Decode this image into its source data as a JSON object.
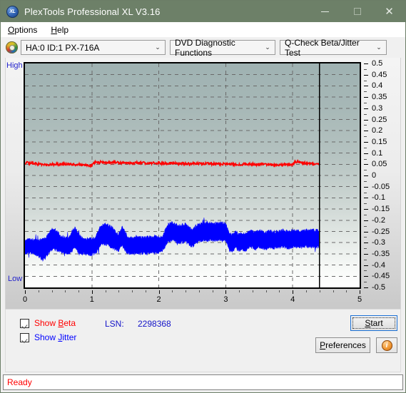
{
  "window": {
    "title": "PlexTools Professional XL V3.16",
    "icon": "xl-disc-icon",
    "minimize_label": "–",
    "maximize_label": "□",
    "close_label": "✕",
    "titlebar_color": "#6d8068"
  },
  "menu": {
    "items": [
      {
        "label": "Options",
        "accel": "O"
      },
      {
        "label": "Help",
        "accel": "H"
      }
    ]
  },
  "toolbar": {
    "drive_icon": "optical-disc-icon",
    "drive_select": "HA:0 ID:1  PX-716A",
    "function_select": "DVD Diagnostic Functions",
    "test_select": "Q-Check Beta/Jitter Test",
    "chevron": "⌄"
  },
  "controls": {
    "show_beta_label": "Show Beta",
    "show_beta_accel": "B",
    "show_beta_checked": true,
    "show_beta_color": "#ff0000",
    "show_jitter_label": "Show Jitter",
    "show_jitter_accel": "J",
    "show_jitter_checked": true,
    "show_jitter_color": "#0000ff",
    "lsn_label": "LSN:",
    "lsn_value": "2298368",
    "start_label": "Start",
    "start_accel": "S",
    "preferences_label": "Preferences",
    "preferences_accel": "P",
    "info_label": "i"
  },
  "status": {
    "text": "Ready"
  },
  "chart_data": {
    "type": "line",
    "title": "",
    "xlabel": "",
    "ylabel": "",
    "left_axis_top_label": "High",
    "left_axis_bottom_label": "Low",
    "left_axis_label_color": "#2222cc",
    "xlim": [
      0,
      5
    ],
    "x_ticks": [
      0,
      1,
      2,
      3,
      4,
      5
    ],
    "x_minor_per_major": 5,
    "ylim": [
      -0.5,
      0.5
    ],
    "y_ticks": [
      0.5,
      0.45,
      0.4,
      0.35,
      0.3,
      0.25,
      0.2,
      0.15,
      0.1,
      0.05,
      0,
      -0.05,
      -0.1,
      -0.15,
      -0.2,
      -0.25,
      -0.3,
      -0.35,
      -0.4,
      -0.45,
      -0.5
    ],
    "grid": true,
    "grid_style": "dashed",
    "grid_color": "#6a6a6a",
    "background_gradient": [
      "#9fb2b2",
      "#ffffff"
    ],
    "cursor_line_x": 4.4,
    "cursor_line_color": "#000000",
    "data_end_x": 4.4,
    "series": [
      {
        "name": "Beta",
        "color": "#ff0000",
        "noise": 0.006,
        "x": [
          0.0,
          0.1,
          0.2,
          0.3,
          0.4,
          0.5,
          0.6,
          0.7,
          0.8,
          0.9,
          1.0,
          1.05,
          1.1,
          1.2,
          1.3,
          1.4,
          1.5,
          1.6,
          1.7,
          1.8,
          1.9,
          2.0,
          2.1,
          2.2,
          2.3,
          2.4,
          2.5,
          2.6,
          2.7,
          2.8,
          2.9,
          3.0,
          3.1,
          3.2,
          3.3,
          3.4,
          3.5,
          3.6,
          3.7,
          3.8,
          3.9,
          4.0,
          4.05,
          4.1,
          4.2,
          4.3,
          4.4
        ],
        "values": [
          0.057,
          0.054,
          0.05,
          0.046,
          0.049,
          0.05,
          0.05,
          0.049,
          0.048,
          0.047,
          0.045,
          0.062,
          0.06,
          0.058,
          0.057,
          0.057,
          0.056,
          0.056,
          0.056,
          0.055,
          0.055,
          0.055,
          0.054,
          0.054,
          0.054,
          0.053,
          0.053,
          0.053,
          0.052,
          0.052,
          0.052,
          0.051,
          0.051,
          0.05,
          0.05,
          0.05,
          0.049,
          0.049,
          0.049,
          0.048,
          0.048,
          0.048,
          0.062,
          0.06,
          0.055,
          0.05,
          0.049
        ]
      },
      {
        "name": "Jitter",
        "color": "#0000ff",
        "band": true,
        "x": [
          0.0,
          0.05,
          0.1,
          0.15,
          0.2,
          0.25,
          0.3,
          0.35,
          0.4,
          0.45,
          0.5,
          0.55,
          0.6,
          0.65,
          0.7,
          0.75,
          0.8,
          0.85,
          0.9,
          0.95,
          1.0,
          1.05,
          1.1,
          1.15,
          1.2,
          1.25,
          1.3,
          1.35,
          1.4,
          1.45,
          1.5,
          1.55,
          1.6,
          1.65,
          1.7,
          1.75,
          1.8,
          1.85,
          1.9,
          1.95,
          2.0,
          2.05,
          2.1,
          2.15,
          2.2,
          2.25,
          2.3,
          2.35,
          2.4,
          2.45,
          2.5,
          2.55,
          2.6,
          2.65,
          2.7,
          2.75,
          2.8,
          2.85,
          2.9,
          2.95,
          3.0,
          3.05,
          3.1,
          3.15,
          3.2,
          3.25,
          3.3,
          3.35,
          3.4,
          3.45,
          3.5,
          3.55,
          3.6,
          3.65,
          3.7,
          3.75,
          3.8,
          3.85,
          3.9,
          3.95,
          4.0,
          4.05,
          4.1,
          4.15,
          4.2,
          4.25,
          4.3,
          4.35,
          4.4
        ],
        "upper": [
          -0.3,
          -0.295,
          -0.292,
          -0.295,
          -0.297,
          -0.295,
          -0.29,
          -0.27,
          -0.245,
          -0.25,
          -0.265,
          -0.28,
          -0.285,
          -0.29,
          -0.26,
          -0.24,
          -0.27,
          -0.288,
          -0.29,
          -0.292,
          -0.292,
          -0.285,
          -0.25,
          -0.23,
          -0.225,
          -0.232,
          -0.24,
          -0.26,
          -0.27,
          -0.235,
          -0.265,
          -0.285,
          -0.287,
          -0.286,
          -0.285,
          -0.285,
          -0.284,
          -0.283,
          -0.283,
          -0.282,
          -0.282,
          -0.28,
          -0.25,
          -0.222,
          -0.22,
          -0.225,
          -0.24,
          -0.228,
          -0.226,
          -0.24,
          -0.25,
          -0.235,
          -0.225,
          -0.222,
          -0.22,
          -0.222,
          -0.223,
          -0.222,
          -0.221,
          -0.22,
          -0.221,
          -0.268,
          -0.272,
          -0.26,
          -0.272,
          -0.265,
          -0.27,
          -0.258,
          -0.255,
          -0.262,
          -0.255,
          -0.258,
          -0.262,
          -0.255,
          -0.258,
          -0.26,
          -0.255,
          -0.252,
          -0.256,
          -0.258,
          -0.253,
          -0.252,
          -0.255,
          -0.254,
          -0.252,
          -0.255,
          -0.253,
          -0.254,
          -0.255
        ],
        "lower": [
          -0.345,
          -0.34,
          -0.338,
          -0.342,
          -0.348,
          -0.37,
          -0.362,
          -0.34,
          -0.318,
          -0.322,
          -0.33,
          -0.335,
          -0.336,
          -0.34,
          -0.33,
          -0.312,
          -0.335,
          -0.34,
          -0.342,
          -0.344,
          -0.346,
          -0.34,
          -0.32,
          -0.3,
          -0.298,
          -0.305,
          -0.312,
          -0.322,
          -0.33,
          -0.3,
          -0.33,
          -0.338,
          -0.34,
          -0.34,
          -0.34,
          -0.34,
          -0.338,
          -0.338,
          -0.338,
          -0.337,
          -0.336,
          -0.332,
          -0.305,
          -0.285,
          -0.282,
          -0.288,
          -0.3,
          -0.29,
          -0.288,
          -0.3,
          -0.31,
          -0.296,
          -0.286,
          -0.282,
          -0.28,
          -0.282,
          -0.284,
          -0.282,
          -0.282,
          -0.281,
          -0.282,
          -0.325,
          -0.33,
          -0.318,
          -0.33,
          -0.322,
          -0.328,
          -0.315,
          -0.312,
          -0.32,
          -0.312,
          -0.315,
          -0.32,
          -0.312,
          -0.316,
          -0.318,
          -0.312,
          -0.31,
          -0.314,
          -0.316,
          -0.31,
          -0.309,
          -0.312,
          -0.311,
          -0.309,
          -0.312,
          -0.31,
          -0.311,
          -0.312
        ]
      }
    ]
  }
}
